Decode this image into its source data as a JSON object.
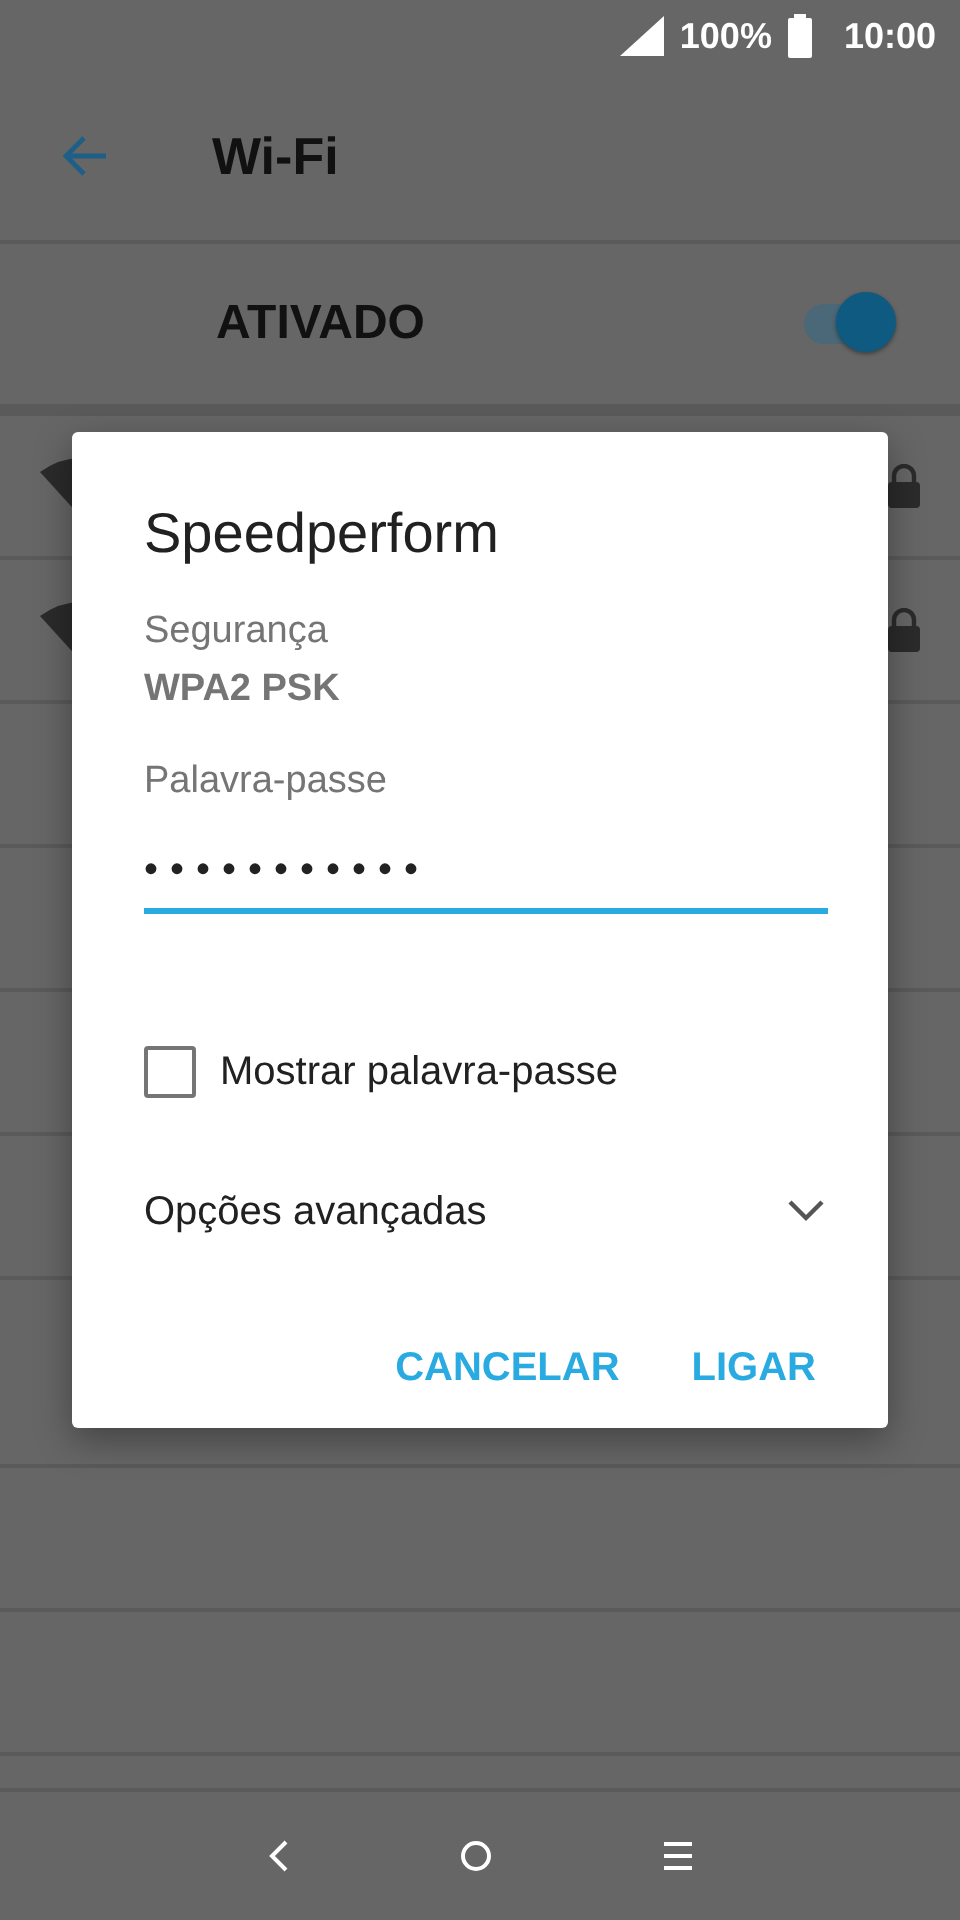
{
  "status_bar": {
    "battery": "100%",
    "time": "10:00"
  },
  "app_bar": {
    "title": "Wi-Fi"
  },
  "wifi_switch": {
    "label": "ATIVADO",
    "on": true
  },
  "dialog": {
    "title": "Speedperform",
    "security_label": "Segurança",
    "security_value": "WPA2 PSK",
    "password_label": "Palavra-passe",
    "password": "•••••••••••",
    "show_password": {
      "label": "Mostrar palavra-passe",
      "checked": false
    },
    "advanced": {
      "label": "Opções avançadas",
      "expanded": false
    },
    "buttons": [
      "CANCELAR",
      "LIGAR"
    ]
  }
}
